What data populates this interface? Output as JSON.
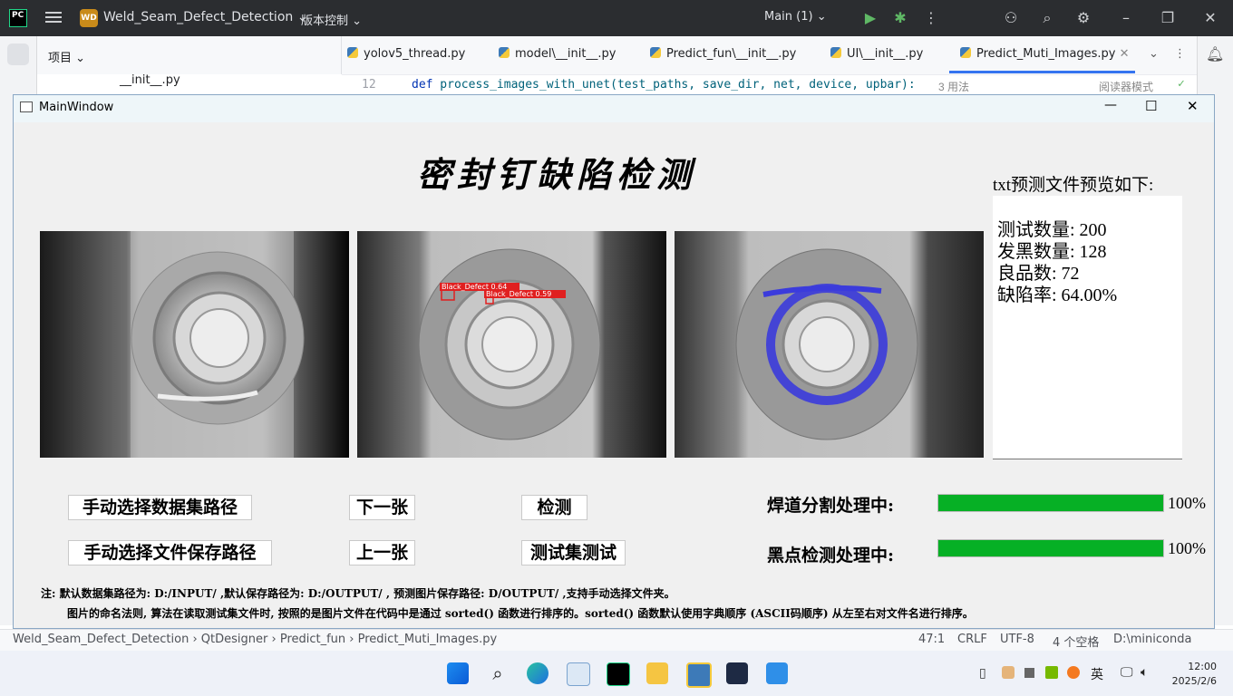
{
  "ide": {
    "logo": "PC",
    "project_badge": "WD",
    "project_name": "Weld_Seam_Defect_Detection",
    "vcs_label": "版本控制",
    "branch": "Main (1)",
    "project_panel_title": "项目",
    "project_tree_file": "__init__.py",
    "tabs": [
      {
        "label": "yolov5_thread.py"
      },
      {
        "label": "model\\__init__.py"
      },
      {
        "label": "Predict_fun\\__init__.py"
      },
      {
        "label": "UI\\__init__.py"
      },
      {
        "label": "Predict_Muti_Images.py"
      }
    ],
    "code": {
      "line_number": "12",
      "keyword": "def",
      "text": " process_images_with_unet(test_paths, save_dir, net, device, upbar):",
      "usages": "3 用法",
      "reader_mode": "阅读器模式"
    }
  },
  "window": {
    "title": "MainWindow",
    "controls": [
      "—",
      "☐",
      "✕"
    ]
  },
  "app": {
    "title": "密封钉缺陷检测",
    "preview_label": "txt预测文件预览如下:",
    "preview_lines": [
      "测试数量: 200",
      "发黑数量: 128",
      "良品数: 72",
      "缺陷率: 64.00%"
    ],
    "detection_labels": [
      "Black_Defect 0.64",
      "Black_Defect 0.59"
    ],
    "buttons": {
      "select_dataset": "手动选择数据集路径",
      "next": "下一张",
      "detect": "检测",
      "select_save": "手动选择文件保存路径",
      "prev": "上一张",
      "test_set": "测试集测试"
    },
    "progress": [
      {
        "label": "焊道分割处理中:",
        "value": 1.0,
        "text": "100%"
      },
      {
        "label": "黑点检测处理中:",
        "value": 1.0,
        "text": "100%"
      }
    ],
    "notes": [
      "注: 默认数据集路径为: D:/INPUT/ ,默认保存路径为: D:/OUTPUT/ , 预测图片保存路径: D/OUTPUT/ ,支持手动选择文件夹。",
      "图片的命名法则, 算法在读取测试集文件时, 按照的是图片文件在代码中是通过 sorted() 函数进行排序的。sorted() 函数默认使用字典顺序 (ASCII码顺序) 从左至右对文件名进行排序。"
    ]
  },
  "statusbar": {
    "breadcrumb": [
      "Weld_Seam_Defect_Detection",
      "QtDesigner",
      "Predict_fun",
      "Predict_Muti_Images.py"
    ],
    "position": "47:1",
    "line_ending": "CRLF",
    "encoding": "UTF-8",
    "indent": "4 个空格",
    "interpreter": "D:\\miniconda"
  },
  "taskbar": {
    "ime": "英",
    "time": "12:00",
    "date": "2025/2/6"
  },
  "colors": {
    "progress_fill": "#06b025",
    "accent": "#3574f0",
    "ide_dark": "#2b2d30",
    "segmentation": "#3b3bdc",
    "defect_box": "#e02020"
  }
}
